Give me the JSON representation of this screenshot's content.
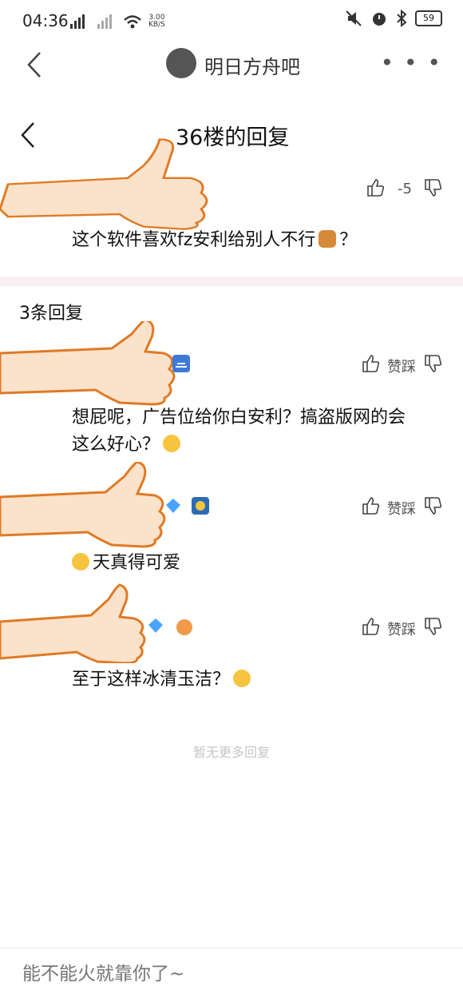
{
  "status_bar": {
    "time": "04:36",
    "speed_value": "3.00",
    "speed_unit": "KB/S",
    "battery": "59"
  },
  "forum": {
    "title": "明日方舟吧"
  },
  "reply_page": {
    "title": "36楼的回复"
  },
  "main_post": {
    "vote_count": "-5",
    "text": "这个软件喜欢fz安利给别人不行"
  },
  "replies_header": "3条回复",
  "replies": [
    {
      "like_label": "赞",
      "dislike_label": "踩",
      "text_line1": "想屁呢，广告位给你白安利？搞盗版网的会",
      "text_line2": "这么好心？"
    },
    {
      "like_label": "赞",
      "dislike_label": "踩",
      "text": "天真得可爱"
    },
    {
      "like_label": "赞",
      "dislike_label": "踩",
      "text": "至于这样冰清玉洁？"
    }
  ],
  "no_more": "暂无更多回复",
  "input": {
    "placeholder": "能不能火就靠你了~"
  },
  "icons": {
    "back": "chevron-left-icon",
    "like": "thumbs-up-icon",
    "dislike": "thumbs-down-icon",
    "more": "more-dots-icon",
    "overlay": "thumbs-up-hand-sticker"
  },
  "colors": {
    "divider": "#f7eff1",
    "hand_fill": "#fbe2cb",
    "hand_stroke": "#e07a25",
    "hint_text": "#c6c6c6"
  }
}
